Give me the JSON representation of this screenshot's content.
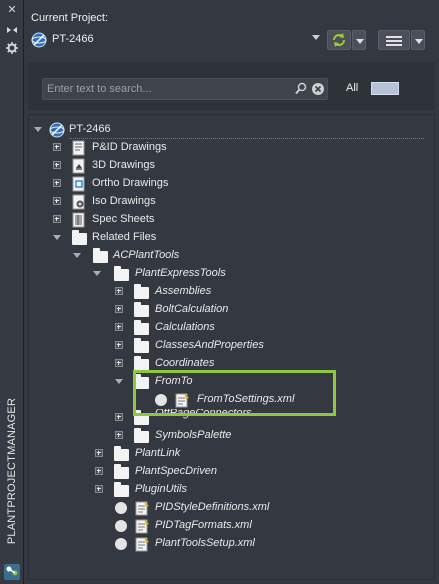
{
  "app": {
    "palette_title": "PLANTPROJECTMANAGER"
  },
  "header": {
    "current_project_label": "Current Project:",
    "project_name": "PT-2466"
  },
  "search": {
    "placeholder": "Enter text to search...",
    "all_label": "All"
  },
  "tree": {
    "root": "PT-2466",
    "items": [
      {
        "label": "P&ID Drawings"
      },
      {
        "label": "3D Drawings"
      },
      {
        "label": "Ortho Drawings"
      },
      {
        "label": "Iso Drawings"
      },
      {
        "label": "Spec Sheets"
      },
      {
        "label": "Related Files"
      },
      {
        "label": "ACPlantTools"
      },
      {
        "label": "PlantExpressTools"
      },
      {
        "label": "Assemblies"
      },
      {
        "label": "BoltCalculation"
      },
      {
        "label": "Calculations"
      },
      {
        "label": "ClassesAndProperties"
      },
      {
        "label": "Coordinates"
      },
      {
        "label": "FromTo"
      },
      {
        "label": "FromToSettings.xml"
      },
      {
        "label": "OffPageConnectors"
      },
      {
        "label": "SymbolsPalette"
      },
      {
        "label": "PlantLink"
      },
      {
        "label": "PlantSpecDriven"
      },
      {
        "label": "PluginUtils"
      },
      {
        "label": "PIDStyleDefinitions.xml"
      },
      {
        "label": "PIDTagFormats.xml"
      },
      {
        "label": "PlantToolsSetup.xml"
      }
    ]
  },
  "colors": {
    "panel_bg": "#343841",
    "highlight": "#8dc63f",
    "all_swatch": "#b7c2d8"
  }
}
